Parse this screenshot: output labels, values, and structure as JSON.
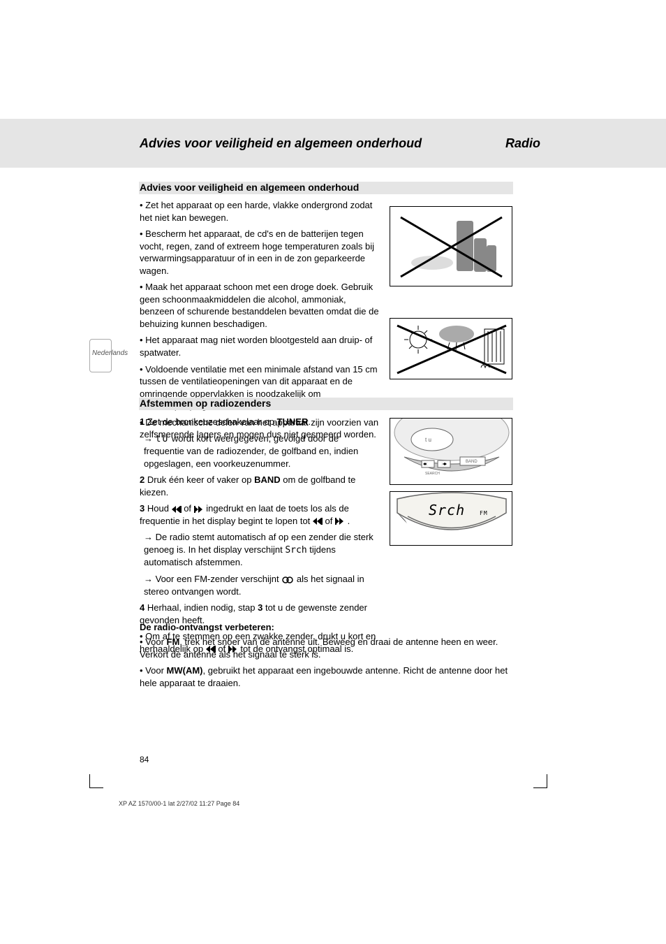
{
  "header": {
    "section_left": "Advies voor veiligheid en algemeen onderhoud",
    "section_right": "Radio"
  },
  "tab_label": "Nederlands",
  "maintenance": {
    "title": "Advies voor veiligheid en algemeen onderhoud",
    "para1": [
      "Zet het apparaat op een harde, vlakke ondergrond zodat het niet kan bewegen.",
      "Bescherm het apparaat, de cd's en de batterijen tegen vocht, regen, zand of extreem hoge temperaturen zoals bij verwarmingsapparatuur of in een in de zon geparkeerde wagen.",
      "Maak het apparaat schoon met een droge doek. Gebruik geen schoonmaakmiddelen die alcohol, ammoniak, benzeen of schurende bestanddelen bevatten omdat die de behuizing kunnen beschadigen.",
      "Het apparaat mag niet worden blootgesteld aan druip- of spatwater.",
      "Voldoende ventilatie met een minimale afstand van 15 cm tussen de ventilatieopeningen van dit apparaat en de omringende oppervlakken is noodzakelijk om warmteophoping te voorkomen.",
      "De mechanische delen van het apparaat zijn voorzien van zelfsmerende lagers en mogen dus niet gesmeerd worden."
    ]
  },
  "radio": {
    "title": "Afstemmen op radiozenders",
    "step1_a": "Zet de bronkeuzeschakelaar op ",
    "step1_b": "TUNER",
    "step1_c": ".",
    "step1_result_a": " wordt kort weergegeven, gevolgd door de frequentie van de radiozender, de golfband en, indien opgeslagen, een voorkeuzenummer.",
    "step2_a": "Druk één keer of vaker op ",
    "step2_b": "BAND",
    "step2_c": " om de golfband te kiezen.",
    "step3_a": "Houd ",
    "step3_b": " of ",
    "step3_c": " ingedrukt en laat de toets los als de frequentie in het display begint te lopen tot ",
    "step3_d": " of ",
    "step3_e": ".",
    "step3_result1_a": "De radio stemt automatisch af op een zender die sterk genoeg is. In het display verschijnt ",
    "step3_result1_b": " tijdens automatisch afstemmen.",
    "step3_result2_a": "Voor een FM-zender verschijnt ",
    "step3_result2_b": " als het signaal in stereo ontvangen wordt.",
    "step4_a": "Herhaal, indien nodig, stap ",
    "step4_b": "3",
    "step4_c": " tot u de gewenste zender gevonden heeft.",
    "manual_a": "Om af te stemmen op een zwakke zender, drukt u kort en herhaaldelijk op ",
    "manual_b": " of ",
    "manual_c": " tot de ontvangst optimaal is.",
    "srch_label": "Srch"
  },
  "improve": {
    "title": "De radio-ontvangst verbeteren:",
    "fm_a": "Voor ",
    "fm_b": "FM",
    "fm_c": ", trek het snoer van de antenne uit. Beweeg en draai de antenne heen en weer. Verkort de antenne als het signaal te sterk is.",
    "mw_a": "Voor ",
    "mw_b": "MW(AM)",
    "mw_c": ", gebruikt het apparaat een ingebouwde antenne. Richt de antenne door het hele apparaat te draaien."
  },
  "page_number": "84",
  "footer_filename": "XP AZ 1570/00-1 lat  2/27/02 11:27  Page 84",
  "display_text": "Srch",
  "display_band": "FM"
}
